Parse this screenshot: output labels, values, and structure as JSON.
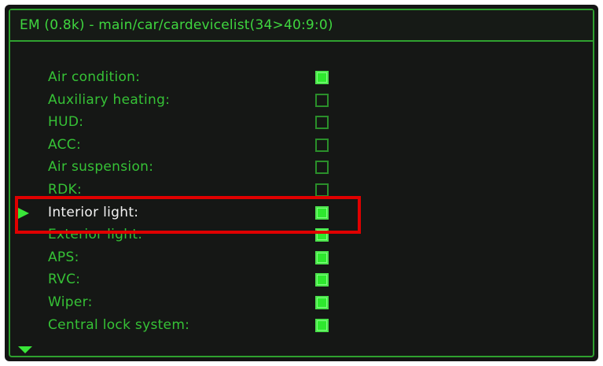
{
  "header": {
    "title": "EM (0.8k) - main/car/cardevicelist(34>40:9:0)"
  },
  "colors": {
    "accent_green": "#2fa12f",
    "text_green": "#36c236",
    "checked_fill": "#2ee82e",
    "highlight_red": "#e00000",
    "background": "#151715"
  },
  "icons": {
    "selection_pointer": "pointer-icon",
    "scroll_down": "scroll-down-icon"
  },
  "list": {
    "selected_index": 6,
    "items": [
      {
        "label": "Air condition:",
        "checked": true
      },
      {
        "label": "Auxiliary heating:",
        "checked": false
      },
      {
        "label": "HUD:",
        "checked": false
      },
      {
        "label": "ACC:",
        "checked": false
      },
      {
        "label": "Air suspension:",
        "checked": false
      },
      {
        "label": "RDK:",
        "checked": false
      },
      {
        "label": "Interior light:",
        "checked": true
      },
      {
        "label": "Exterior light:",
        "checked": true
      },
      {
        "label": "APS:",
        "checked": true
      },
      {
        "label": "RVC:",
        "checked": true
      },
      {
        "label": "Wiper:",
        "checked": true
      },
      {
        "label": "Central lock system:",
        "checked": true
      }
    ]
  }
}
